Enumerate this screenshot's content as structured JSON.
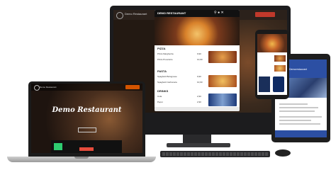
{
  "imac": {
    "brand": "Demo Restaurant",
    "modal": {
      "title": "DEMO RESTAURANT",
      "sections": [
        {
          "name": "PIZZA",
          "items": [
            {
              "name": "Pizza Margherita",
              "price": "9,90"
            },
            {
              "name": "Pizza Prosciutto",
              "price": "10,90"
            }
          ]
        },
        {
          "name": "PASTA",
          "items": [
            {
              "name": "Spaghetti Bolognese",
              "price": "9,90"
            },
            {
              "name": "Spaghetti Carbonara",
              "price": "10,90"
            }
          ]
        },
        {
          "name": "DRINKS",
          "items": [
            {
              "name": "Cola",
              "price": "2,90"
            },
            {
              "name": "Pepsi",
              "price": "2,90"
            }
          ]
        }
      ]
    }
  },
  "laptop": {
    "brand": "Demo Restaurant",
    "hero_title": "Demo Restaurant"
  },
  "tablet": {
    "brand": "Demorestaurant"
  },
  "colors": {
    "accent": "#d35400",
    "tablet_header": "#2c4fa3"
  }
}
